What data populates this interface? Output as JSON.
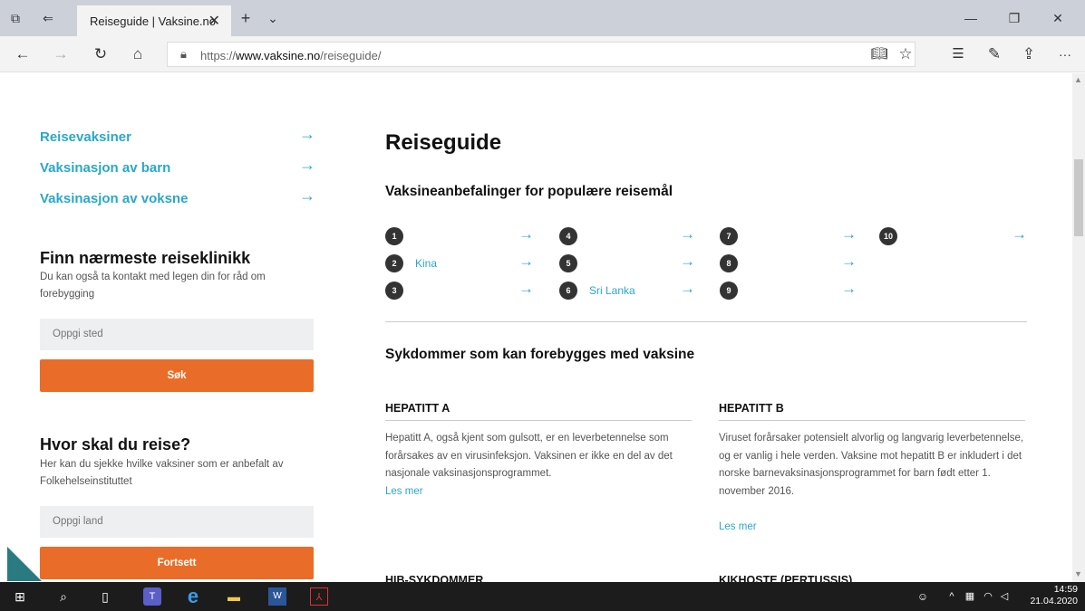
{
  "browser": {
    "tab_title": "Reiseguide | Vaksine.no",
    "tab_close": "✕",
    "new_tab": "+",
    "tab_menu": "⌄",
    "url_prefix": "https://",
    "url_domain": "www.vaksine.no",
    "url_path": "/reiseguide/",
    "more": "···"
  },
  "sidebar": {
    "links": [
      {
        "label": "Reisevaksiner"
      },
      {
        "label": "Vaksinasjon av barn"
      },
      {
        "label": "Vaksinasjon av voksne"
      }
    ],
    "clinic": {
      "heading": "Finn nærmeste reiseklinikk",
      "text": "Du kan også ta kontakt med legen din for råd om forebygging",
      "placeholder": "Oppgi sted",
      "button": "Søk"
    },
    "travel": {
      "heading": "Hvor skal du reise?",
      "text": "Her kan du sjekke hvilke vaksiner som er anbefalt av Folkehelseinstituttet",
      "placeholder": "Oppgi land",
      "button": "Fortsett"
    }
  },
  "main": {
    "title": "Reiseguide",
    "destinations_heading": "Vaksineanbefalinger for populære reisemål",
    "destinations": [
      {
        "num": "1",
        "name": ""
      },
      {
        "num": "2",
        "name": "Kina"
      },
      {
        "num": "3",
        "name": ""
      },
      {
        "num": "4",
        "name": ""
      },
      {
        "num": "5",
        "name": ""
      },
      {
        "num": "6",
        "name": "Sri Lanka"
      },
      {
        "num": "7",
        "name": ""
      },
      {
        "num": "8",
        "name": ""
      },
      {
        "num": "9",
        "name": ""
      },
      {
        "num": "10",
        "name": ""
      }
    ],
    "diseases_heading": "Sykdommer som kan forebygges med vaksine",
    "diseases": [
      {
        "title": "HEPATITT A",
        "body": "Hepatitt A, også kjent som gulsott, er en leverbetennelse som forårsakes av en virusinfeksjon. Vaksinen er ikke en del av det nasjonale vaksinasjonsprogrammet.",
        "link": "Les mer"
      },
      {
        "title": "HEPATITT B",
        "body": "Viruset forårsaker potensielt alvorlig og langvarig leverbetennelse, og er vanlig i hele verden. Vaksine mot hepatitt B er inkludert i det norske barnevaksinasjonsprogrammet for barn født etter 1. november 2016.",
        "link": "Les mer"
      },
      {
        "title": "HIB-SYKDOMMER"
      },
      {
        "title": "KIKHOSTE (PERTUSSIS)"
      }
    ],
    "arrow": "→"
  },
  "taskbar": {
    "time": "14:59",
    "date": "21.04.2020"
  },
  "colors": {
    "accent": "#29a8c9",
    "button": "#e96d28",
    "badge": "#333333"
  }
}
